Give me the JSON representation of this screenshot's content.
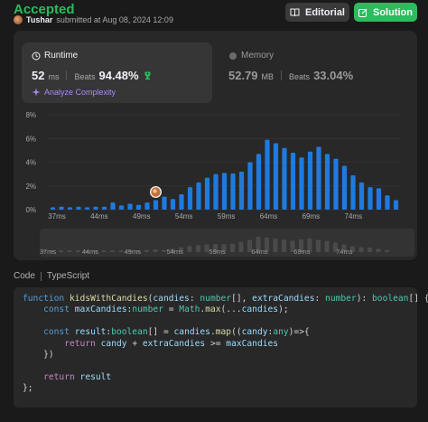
{
  "status": {
    "title": "Accepted"
  },
  "submission": {
    "user": "Tushar",
    "submitted_text": "submitted at Aug 08, 2024 12:09"
  },
  "actions": {
    "editorial": "Editorial",
    "solution": "Solution"
  },
  "runtime": {
    "title": "Runtime",
    "value": "52",
    "unit": "ms",
    "beats_label": "Beats",
    "beats_pct": "94.48%",
    "analyze": "Analyze Complexity"
  },
  "memory": {
    "title": "Memory",
    "value": "52.79",
    "unit": "MB",
    "beats_label": "Beats",
    "beats_pct": "33.04%"
  },
  "colors": {
    "accepted": "#2cbb5d",
    "bar": "#1f7ae0",
    "bar_muted": "#3a3a3a",
    "accent_purple": "#a88bfa"
  },
  "chart_data": {
    "type": "bar",
    "x_tick_labels": [
      "37ms",
      "44ms",
      "49ms",
      "54ms",
      "59ms",
      "64ms",
      "69ms",
      "74ms"
    ],
    "y_tick_labels": [
      "0%",
      "2%",
      "4%",
      "6%",
      "8%"
    ],
    "ylim": [
      0,
      8
    ],
    "values": [
      0.2,
      0.25,
      0.2,
      0.25,
      0.2,
      0.25,
      0.25,
      0.6,
      0.35,
      0.5,
      0.4,
      0.6,
      0.8,
      1.1,
      0.9,
      1.3,
      1.9,
      2.3,
      2.7,
      3.0,
      3.1,
      3.05,
      3.2,
      4.0,
      4.7,
      5.9,
      5.6,
      5.2,
      4.8,
      4.4,
      4.9,
      5.3,
      4.7,
      4.3,
      3.7,
      2.9,
      2.3,
      1.9,
      1.8,
      1.2,
      0.8
    ],
    "highlight_index": 12
  },
  "code": {
    "tabs": [
      "Code",
      "TypeScript"
    ],
    "lines": [
      [
        [
          "kw",
          "function "
        ],
        [
          "fn",
          "kidsWithCandies"
        ],
        [
          "op",
          "("
        ],
        [
          "pm",
          "candies"
        ],
        [
          "op",
          ": "
        ],
        [
          "ty",
          "number"
        ],
        [
          "op",
          "[], "
        ],
        [
          "pm",
          "extraCandies"
        ],
        [
          "op",
          ": "
        ],
        [
          "ty",
          "number"
        ],
        [
          "op",
          "): "
        ],
        [
          "ty",
          "boolean"
        ],
        [
          "op",
          "[] {"
        ]
      ],
      [
        [
          "op",
          "    "
        ],
        [
          "kw",
          "const "
        ],
        [
          "pm",
          "maxCandies"
        ],
        [
          "op",
          ":"
        ],
        [
          "ty",
          "number"
        ],
        [
          "op",
          " = "
        ],
        [
          "ty",
          "Math"
        ],
        [
          "op",
          "."
        ],
        [
          "fn",
          "max"
        ],
        [
          "op",
          "(..."
        ],
        [
          "pm",
          "candies"
        ],
        [
          "op",
          ");"
        ]
      ],
      [
        [
          "op",
          ""
        ]
      ],
      [
        [
          "op",
          "    "
        ],
        [
          "kw",
          "const "
        ],
        [
          "pm",
          "result"
        ],
        [
          "op",
          ":"
        ],
        [
          "ty",
          "boolean"
        ],
        [
          "op",
          "[] = "
        ],
        [
          "pm",
          "candies"
        ],
        [
          "op",
          "."
        ],
        [
          "fn",
          "map"
        ],
        [
          "op",
          "(("
        ],
        [
          "pm",
          "candy"
        ],
        [
          "op",
          ":"
        ],
        [
          "ty",
          "any"
        ],
        [
          "op",
          ")=>{"
        ]
      ],
      [
        [
          "op",
          "        "
        ],
        [
          "ctl",
          "return "
        ],
        [
          "pm",
          "candy"
        ],
        [
          "op",
          " + "
        ],
        [
          "pm",
          "extraCandies"
        ],
        [
          "op",
          " >= "
        ],
        [
          "pm",
          "maxCandies"
        ]
      ],
      [
        [
          "op",
          "    })"
        ]
      ],
      [
        [
          "op",
          ""
        ]
      ],
      [
        [
          "op",
          "    "
        ],
        [
          "ctl",
          "return "
        ],
        [
          "pm",
          "result"
        ]
      ],
      [
        [
          "op",
          "};"
        ]
      ]
    ]
  }
}
